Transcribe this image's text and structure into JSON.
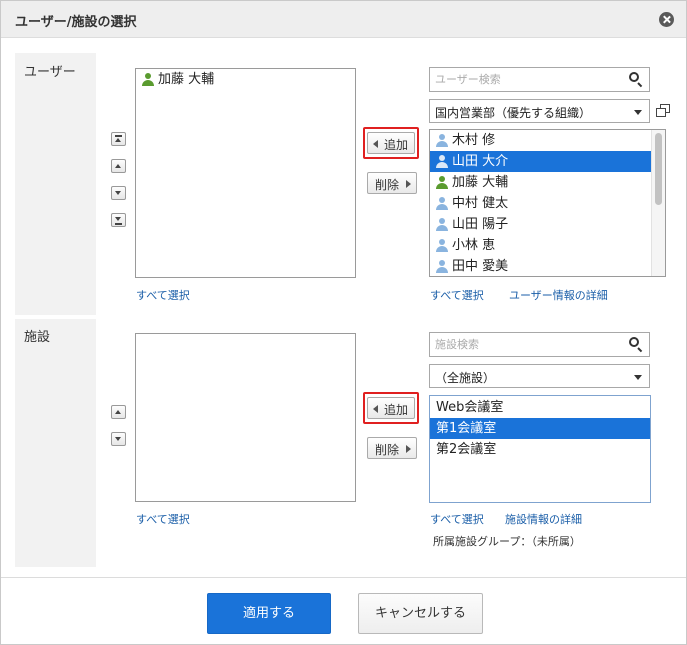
{
  "dialog": {
    "title": "ユーザー/施設の選択"
  },
  "users": {
    "label": "ユーザー",
    "selected": [
      {
        "name": "加藤 大輔",
        "icon": "user-green-icon"
      }
    ],
    "select_all_left": "すべて選択",
    "add_label": "追加",
    "remove_label": "削除",
    "search_placeholder": "ユーザー検索",
    "group_select_value": "国内営業部（優先する組織）",
    "candidates": [
      {
        "name": "木村 修",
        "icon": "user-blue-icon",
        "selected": false
      },
      {
        "name": "山田 大介",
        "icon": "user-blue-icon",
        "selected": true
      },
      {
        "name": "加藤 大輔",
        "icon": "user-green-icon",
        "selected": false
      },
      {
        "name": "中村 健太",
        "icon": "user-blue-icon",
        "selected": false
      },
      {
        "name": "山田 陽子",
        "icon": "user-blue-icon",
        "selected": false
      },
      {
        "name": "小林 恵",
        "icon": "user-blue-icon",
        "selected": false
      },
      {
        "name": "田中 愛美",
        "icon": "user-blue-icon",
        "selected": false
      }
    ],
    "select_all_right": "すべて選択",
    "detail_link": "ユーザー情報の詳細"
  },
  "facilities": {
    "label": "施設",
    "selected": [],
    "select_all_left": "すべて選択",
    "add_label": "追加",
    "remove_label": "削除",
    "search_placeholder": "施設検索",
    "group_select_value": "（全施設）",
    "candidates": [
      {
        "name": "Web会議室",
        "selected": false
      },
      {
        "name": "第1会議室",
        "selected": true
      },
      {
        "name": "第2会議室",
        "selected": false
      }
    ],
    "select_all_right": "すべて選択",
    "detail_link": "施設情報の詳細",
    "group_note": "所属施設グループ：（未所属）"
  },
  "footer": {
    "apply_label": "適用する",
    "cancel_label": "キャンセルする"
  },
  "colors": {
    "primary": "#1a73d9",
    "highlight_frame": "#e02020",
    "link": "#1a5ea8"
  }
}
